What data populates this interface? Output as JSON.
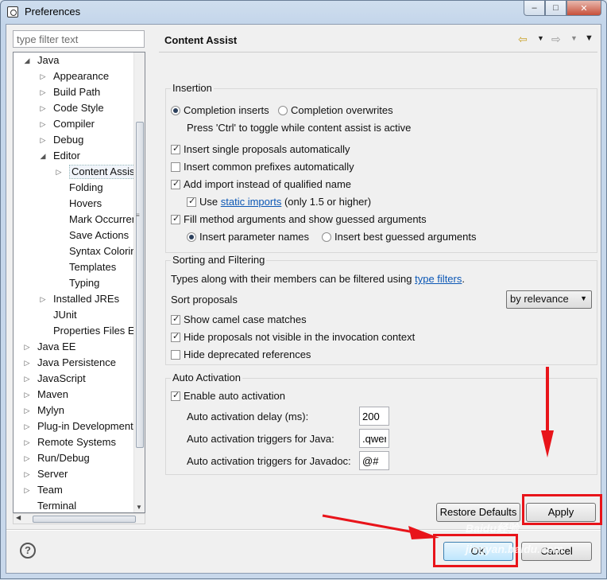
{
  "window": {
    "title": "Preferences",
    "controls": [
      "–",
      "□",
      "✕"
    ]
  },
  "filter": {
    "placeholder": "type filter text"
  },
  "tree": [
    {
      "label": "Java",
      "level": 0,
      "arrow": "◢"
    },
    {
      "label": "Appearance",
      "level": 1,
      "arrow": "▷"
    },
    {
      "label": "Build Path",
      "level": 1,
      "arrow": "▷"
    },
    {
      "label": "Code Style",
      "level": 1,
      "arrow": "▷"
    },
    {
      "label": "Compiler",
      "level": 1,
      "arrow": "▷"
    },
    {
      "label": "Debug",
      "level": 1,
      "arrow": "▷"
    },
    {
      "label": "Editor",
      "level": 1,
      "arrow": "◢"
    },
    {
      "label": "Content Assist",
      "level": 2,
      "arrow": "▷",
      "selected": true
    },
    {
      "label": "Folding",
      "level": 2,
      "arrow": ""
    },
    {
      "label": "Hovers",
      "level": 2,
      "arrow": ""
    },
    {
      "label": "Mark Occurren",
      "level": 2,
      "arrow": ""
    },
    {
      "label": "Save Actions",
      "level": 2,
      "arrow": ""
    },
    {
      "label": "Syntax Coloring",
      "level": 2,
      "arrow": ""
    },
    {
      "label": "Templates",
      "level": 2,
      "arrow": ""
    },
    {
      "label": "Typing",
      "level": 2,
      "arrow": ""
    },
    {
      "label": "Installed JREs",
      "level": 1,
      "arrow": "▷"
    },
    {
      "label": "JUnit",
      "level": 1,
      "arrow": ""
    },
    {
      "label": "Properties Files Ed",
      "level": 1,
      "arrow": ""
    },
    {
      "label": "Java EE",
      "level": 0,
      "arrow": "▷"
    },
    {
      "label": "Java Persistence",
      "level": 0,
      "arrow": "▷"
    },
    {
      "label": "JavaScript",
      "level": 0,
      "arrow": "▷"
    },
    {
      "label": "Maven",
      "level": 0,
      "arrow": "▷"
    },
    {
      "label": "Mylyn",
      "level": 0,
      "arrow": "▷"
    },
    {
      "label": "Plug-in Development",
      "level": 0,
      "arrow": "▷"
    },
    {
      "label": "Remote Systems",
      "level": 0,
      "arrow": "▷"
    },
    {
      "label": "Run/Debug",
      "level": 0,
      "arrow": "▷"
    },
    {
      "label": "Server",
      "level": 0,
      "arrow": "▷"
    },
    {
      "label": "Team",
      "level": 0,
      "arrow": "▷"
    },
    {
      "label": "Terminal",
      "level": 0,
      "arrow": ""
    }
  ],
  "page": {
    "title": "Content Assist",
    "nav": {
      "back": "⇦",
      "forward": "⇨",
      "dropdown": "▼",
      "menu": "▼"
    }
  },
  "insertion": {
    "title": "Insertion",
    "completion_inserts": "Completion inserts",
    "completion_overwrites": "Completion overwrites",
    "toggle_hint": "Press 'Ctrl' to toggle while content assist is active",
    "single_proposals": "Insert single proposals automatically",
    "common_prefixes": "Insert common prefixes automatically",
    "add_import": "Add import instead of qualified name",
    "use_label": "Use",
    "static_imports_link": "static imports",
    "static_imports_suffix": "(only 1.5 or higher)",
    "fill_method_args": "Fill method arguments and show guessed arguments",
    "insert_param_names": "Insert parameter names",
    "insert_best_guessed": "Insert best guessed arguments"
  },
  "sorting": {
    "title": "Sorting and Filtering",
    "types_text": "Types along with their members can be filtered using",
    "type_filters_link": "type filters",
    "period": ".",
    "sort_label": "Sort proposals",
    "sort_value": "by relevance",
    "camel_case": "Show camel case matches",
    "hide_not_visible": "Hide proposals not visible in the invocation context",
    "hide_deprecated": "Hide deprecated references"
  },
  "auto_activation": {
    "title": "Auto Activation",
    "enable": "Enable auto activation",
    "delay_label": "Auto activation delay (ms):",
    "delay_value": "200",
    "java_triggers_label": "Auto activation triggers for Java:",
    "java_triggers_value": ".qwer",
    "javadoc_triggers_label": "Auto activation triggers for Javadoc:",
    "javadoc_triggers_value": "@#"
  },
  "buttons": {
    "restore_defaults": "Restore Defaults",
    "apply": "Apply",
    "ok": "OK",
    "cancel": "Cancel",
    "help": "?"
  },
  "watermark": "Baidu经验 jingyan.baidu.com",
  "colors": {
    "annotation_red": "#e8141a",
    "link": "#0b57b5"
  }
}
